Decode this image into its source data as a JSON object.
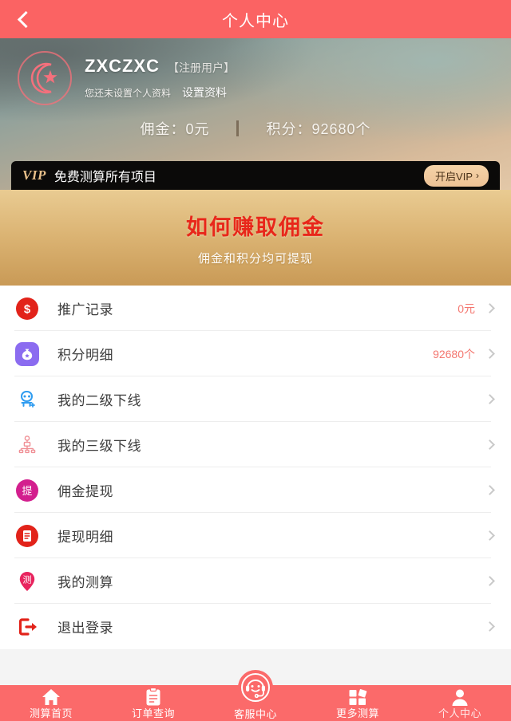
{
  "header": {
    "title": "个人中心",
    "back_icon": "chevron-left-icon"
  },
  "profile": {
    "avatar_icon": "crescent-moon-star-icon",
    "user_name": "ZXCZXC",
    "user_role": "【注册用户】",
    "hint": "您还未设置个人资料",
    "set_profile_link": "设置资料",
    "commission_label": "佣金：",
    "commission_value": "0元",
    "points_label": "积分：",
    "points_value": "92680个"
  },
  "vip": {
    "tag": "VIP",
    "text": "免费测算所有项目",
    "button_label": "开启VIP",
    "button_arrow": "›"
  },
  "promo": {
    "title": "如何赚取佣金",
    "subtitle": "佣金和积分均可提现",
    "title_color": "#e8271a"
  },
  "menu": {
    "items": [
      {
        "icon": "dollar-coin-icon",
        "label": "推广记录",
        "value": "0元"
      },
      {
        "icon": "money-bag-icon",
        "label": "积分明细",
        "value": "92680个"
      },
      {
        "icon": "user-add-icon",
        "label": "我的二级下线",
        "value": ""
      },
      {
        "icon": "hierarchy-tree-icon",
        "label": "我的三级下线",
        "value": ""
      },
      {
        "icon": "withdraw-badge-icon",
        "label": "佣金提现",
        "value": ""
      },
      {
        "icon": "document-list-icon",
        "label": "提现明细",
        "value": ""
      },
      {
        "icon": "map-pin-ce-icon",
        "label": "我的测算",
        "value": ""
      },
      {
        "icon": "logout-icon",
        "label": "退出登录",
        "value": ""
      }
    ]
  },
  "tabbar": {
    "items": [
      {
        "icon": "home-icon",
        "label": "测算首页"
      },
      {
        "icon": "clipboard-icon",
        "label": "订单查询"
      },
      {
        "icon": "headset-face-icon",
        "label": "客服中心"
      },
      {
        "icon": "grid-apps-icon",
        "label": "更多测算"
      },
      {
        "icon": "person-icon",
        "label": "个人中心"
      }
    ],
    "active_index": 4
  },
  "colors": {
    "primary": "#fb6363",
    "gold_light": "#e9cb92",
    "gold_dark": "#c99a56",
    "value_red": "#f4766f"
  }
}
